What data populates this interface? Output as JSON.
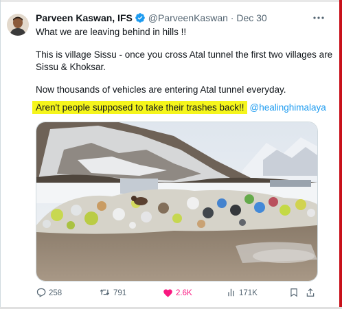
{
  "tweet": {
    "author_name": "Parveen Kaswan, IFS",
    "handle": "@ParveenKaswan",
    "separator": "·",
    "date": "Dec 30",
    "text_lines": [
      "What we are leaving behind in hills !!",
      "This is village Sissu - once you cross Atal tunnel the first two villages are",
      "Sissu & Khoksar.",
      "Now thousands of vehicles are entering Atal tunnel everyday."
    ],
    "highlighted_text": "Aren't people supposed to take their trashes back!!",
    "mention": "@healinghimalaya"
  },
  "image": {
    "alt_subject": "garbage-dump-in-snowy-mountain-village"
  },
  "actions": {
    "replies": "258",
    "retweets": "791",
    "likes": "2.6K",
    "views": "171K"
  },
  "colors": {
    "highlight": "#f5f51c",
    "mention": "#1d9bf0",
    "verified": "#1d9bf0",
    "like": "#f91880",
    "muted": "#536471",
    "frame_accent": "#c8101a"
  }
}
